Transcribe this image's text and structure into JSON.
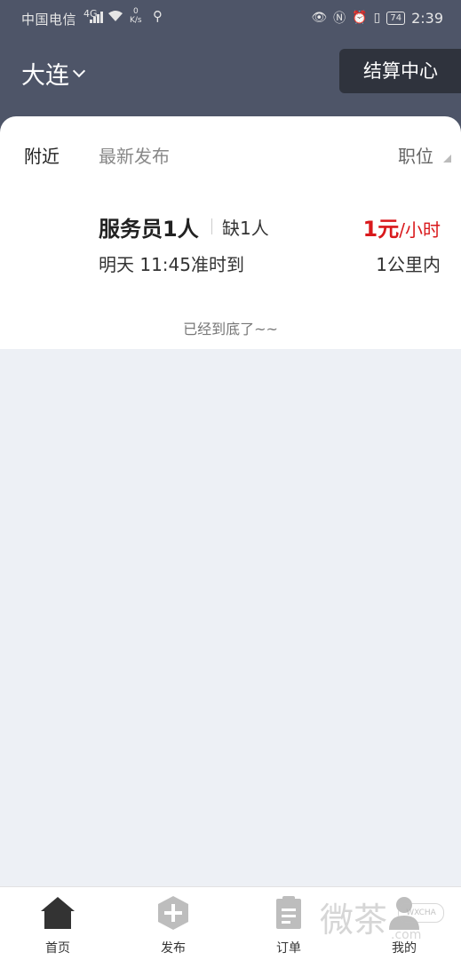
{
  "status_bar": {
    "carrier": "中国电信",
    "network": "4G",
    "speed_value": "0",
    "speed_unit": "K/s",
    "battery": "74",
    "time": "2:39"
  },
  "header": {
    "city": "大连",
    "settle_button": "结算中心"
  },
  "filters": {
    "nearby": "附近",
    "newest": "最新发布",
    "position": "职位"
  },
  "job": {
    "title": "服务员1人",
    "shortage": "缺1人",
    "price_amount": "1元",
    "price_unit": "/小时",
    "time": "明天 11:45准时到",
    "distance": "1公里内"
  },
  "list_end": "已经到底了~~",
  "tabbar": {
    "home": "首页",
    "publish": "发布",
    "orders": "订单",
    "mine": "我的"
  },
  "watermark": {
    "text": "微茶",
    "domain": ".com",
    "badge": "WXCHA"
  }
}
